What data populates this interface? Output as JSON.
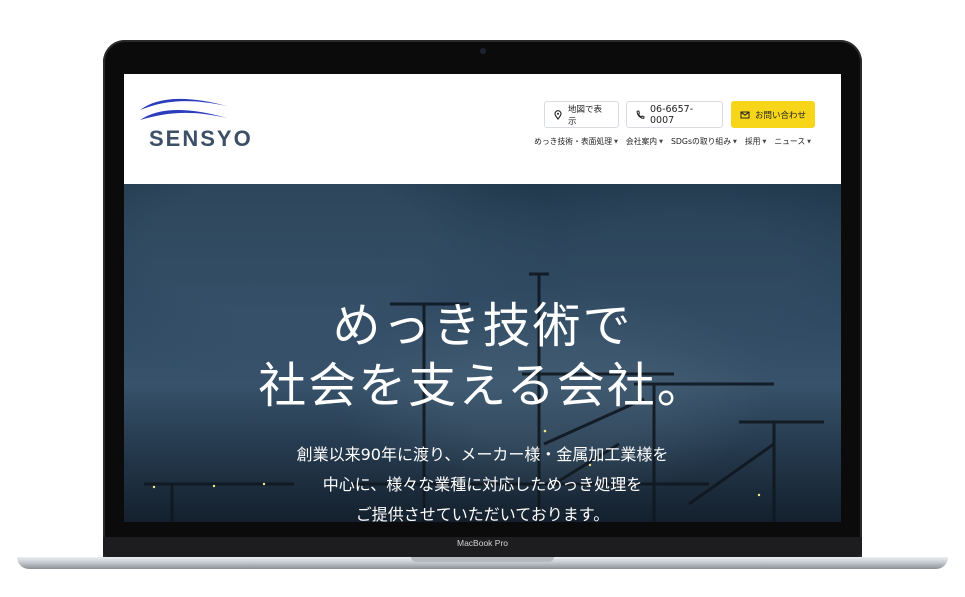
{
  "device": {
    "label": "MacBook Pro"
  },
  "site": {
    "logo_text": "SENSYO",
    "map_button": "地図で表示",
    "phone": "06-6657-0007",
    "contact_button": "お問い合わせ",
    "nav": [
      "めっき技術・表面処理",
      "会社案内",
      "SDGsの取り組み",
      "採用",
      "ニュース"
    ],
    "hero_title": [
      "めっき技術で",
      "社会を支える会社。"
    ],
    "hero_subtitle": [
      "創業以来90年に渡り、メーカー様・金属加工業様を",
      "中心に、様々な業種に対応しためっき処理を",
      "ご提供させていただいております。"
    ]
  },
  "colors": {
    "logo_blue": "#2b3dbb",
    "logo_text": "#3d4f66",
    "accent_yellow": "#f7d619",
    "hero_bg": "#2a455d"
  },
  "icons": [
    "map-pin-icon",
    "phone-icon",
    "mail-icon",
    "nav-caret-icon"
  ]
}
